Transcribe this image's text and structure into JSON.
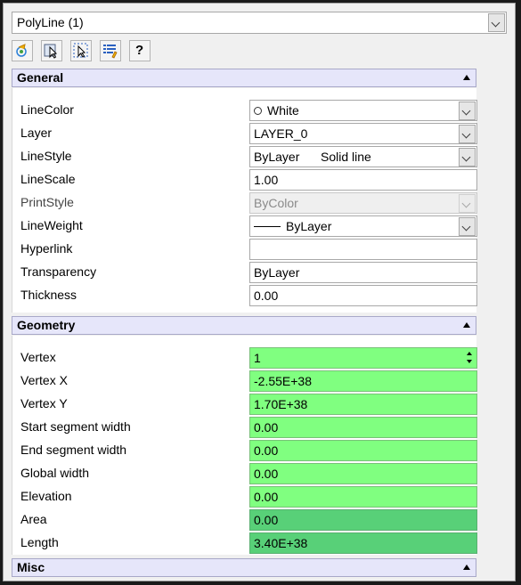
{
  "selector": {
    "value": "PolyLine (1)"
  },
  "toolbar": {
    "buttons": [
      {
        "name": "toggle-pickadd-icon"
      },
      {
        "name": "select-objects-icon"
      },
      {
        "name": "quick-select-icon"
      },
      {
        "name": "properties-list-icon"
      },
      {
        "name": "help-icon",
        "glyph": "?"
      }
    ]
  },
  "general": {
    "title": "General",
    "rows": {
      "linecolor": {
        "label": "LineColor",
        "value": "White"
      },
      "layer": {
        "label": "Layer",
        "value": "LAYER_0"
      },
      "linestyle": {
        "label": "LineStyle",
        "value": "ByLayer",
        "value2": "Solid line"
      },
      "linescale": {
        "label": "LineScale",
        "value": "1.00"
      },
      "printstyle": {
        "label": "PrintStyle",
        "value": "ByColor"
      },
      "lineweight": {
        "label": "LineWeight",
        "value": "ByLayer"
      },
      "hyperlink": {
        "label": "Hyperlink",
        "value": ""
      },
      "transparency": {
        "label": "Transparency",
        "value": "ByLayer"
      },
      "thickness": {
        "label": "Thickness",
        "value": "0.00"
      }
    }
  },
  "geometry": {
    "title": "Geometry",
    "rows": {
      "vertex": {
        "label": "Vertex",
        "value": "1"
      },
      "vertex_x": {
        "label": "Vertex X",
        "value": "-2.55E+38"
      },
      "vertex_y": {
        "label": "Vertex Y",
        "value": "1.70E+38"
      },
      "start_width": {
        "label": "Start segment width",
        "value": "0.00"
      },
      "end_width": {
        "label": "End segment width",
        "value": "0.00"
      },
      "global_width": {
        "label": "Global width",
        "value": "0.00"
      },
      "elevation": {
        "label": "Elevation",
        "value": "0.00"
      },
      "area": {
        "label": "Area",
        "value": "0.00"
      },
      "length": {
        "label": "Length",
        "value": "3.40E+38"
      }
    }
  },
  "misc": {
    "title": "Misc"
  },
  "colors": {
    "header_bg": "#e6e6fa",
    "editable_green": "#80ff80",
    "readonly_green": "#58d078"
  }
}
